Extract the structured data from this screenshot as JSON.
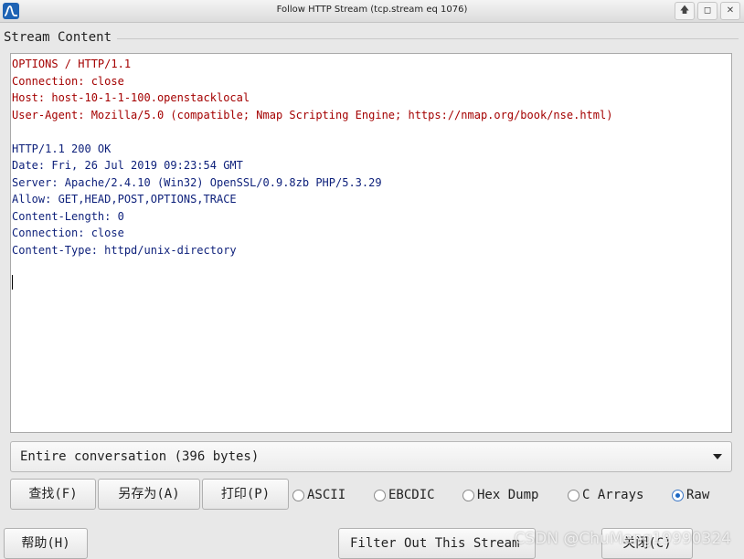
{
  "window": {
    "title": "Follow HTTP Stream (tcp.stream eq 1076)",
    "controls": {
      "up": "🡅",
      "restore": "◻",
      "close": "✕"
    }
  },
  "group": {
    "title": "Stream Content"
  },
  "stream": {
    "request_lines": [
      "OPTIONS / HTTP/1.1",
      "Connection: close",
      "Host: host-10-1-1-100.openstacklocal",
      "User-Agent: Mozilla/5.0 (compatible; Nmap Scripting Engine; https://nmap.org/book/nse.html)"
    ],
    "response_lines": [
      "HTTP/1.1 200 OK",
      "Date: Fri, 26 Jul 2019 09:23:54 GMT",
      "Server: Apache/2.4.10 (Win32) OpenSSL/0.9.8zb PHP/5.3.29",
      "Allow: GET,HEAD,POST,OPTIONS,TRACE",
      "Content-Length: 0",
      "Connection: close",
      "Content-Type: httpd/unix-directory"
    ],
    "request_color": "#a40000",
    "response_color": "#0c1f7a"
  },
  "conversation": {
    "selected": "Entire conversation (396 bytes)"
  },
  "buttons": {
    "find": "查找(F)",
    "save_as": "另存为(A)",
    "print": "打印(P)",
    "help": "帮助(H)",
    "filter_out": "Filter Out This Stream",
    "close": "关闭(C)"
  },
  "formats": {
    "ascii": "ASCII",
    "ebcdic": "EBCDIC",
    "hex_dump": "Hex Dump",
    "c_arrays": "C Arrays",
    "raw": "Raw",
    "selected": "Raw"
  },
  "watermark": "CSDN @ChuMeng19990324"
}
